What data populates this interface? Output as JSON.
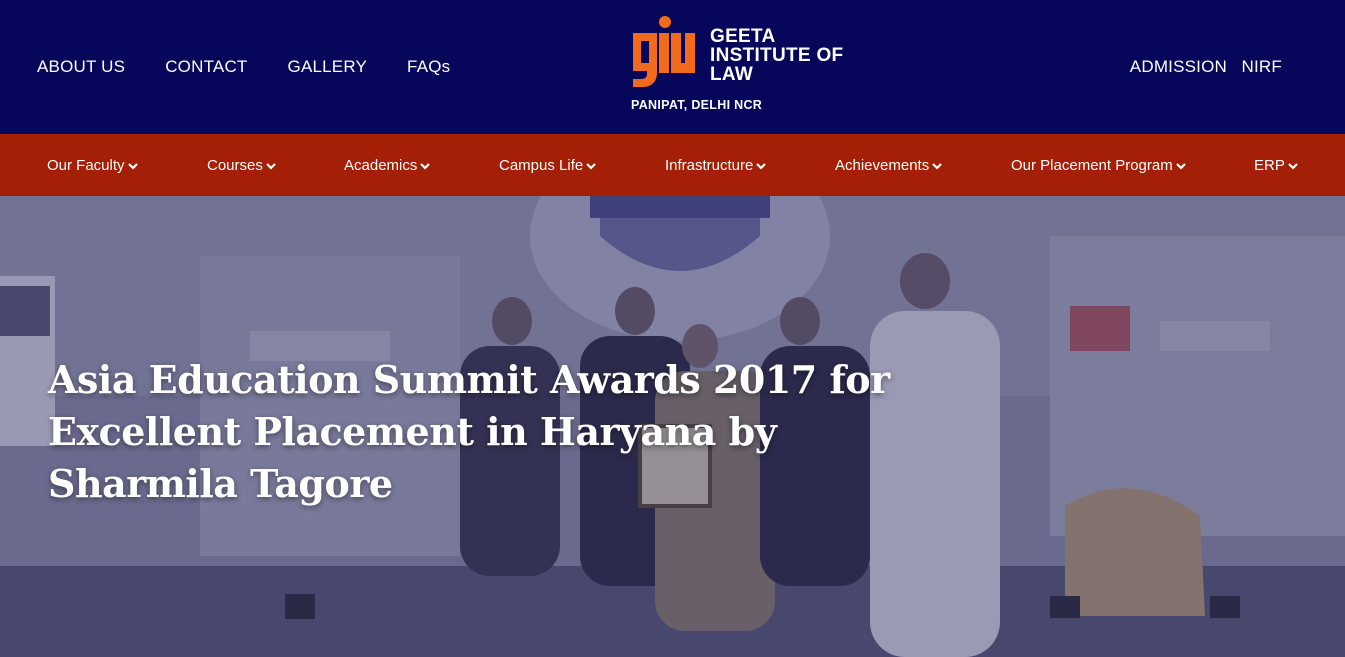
{
  "header": {
    "left_links": [
      "ABOUT US",
      "CONTACT",
      "GALLERY",
      "FAQs"
    ],
    "right_links": [
      "ADMISSION",
      "NIRF"
    ],
    "logo": {
      "name_line1": "GEETA",
      "name_line2": "INSTITUTE OF",
      "name_line3": "LAW",
      "subtitle": "PANIPAT, DELHI NCR",
      "brand_color": "#f26a1b"
    },
    "background": "#06065a"
  },
  "nav": {
    "background": "#a41f06",
    "items": [
      "Our Faculty",
      "Courses",
      "Academics",
      "Campus Life",
      "Infrastructure",
      "Achievements",
      "Our Placement Program",
      "ERP"
    ]
  },
  "hero": {
    "title": "Asia Education Summit Awards 2017 for Excellent Placement in Haryana by Sharmila Tagore",
    "image_subject": "award-ceremony-photo"
  }
}
